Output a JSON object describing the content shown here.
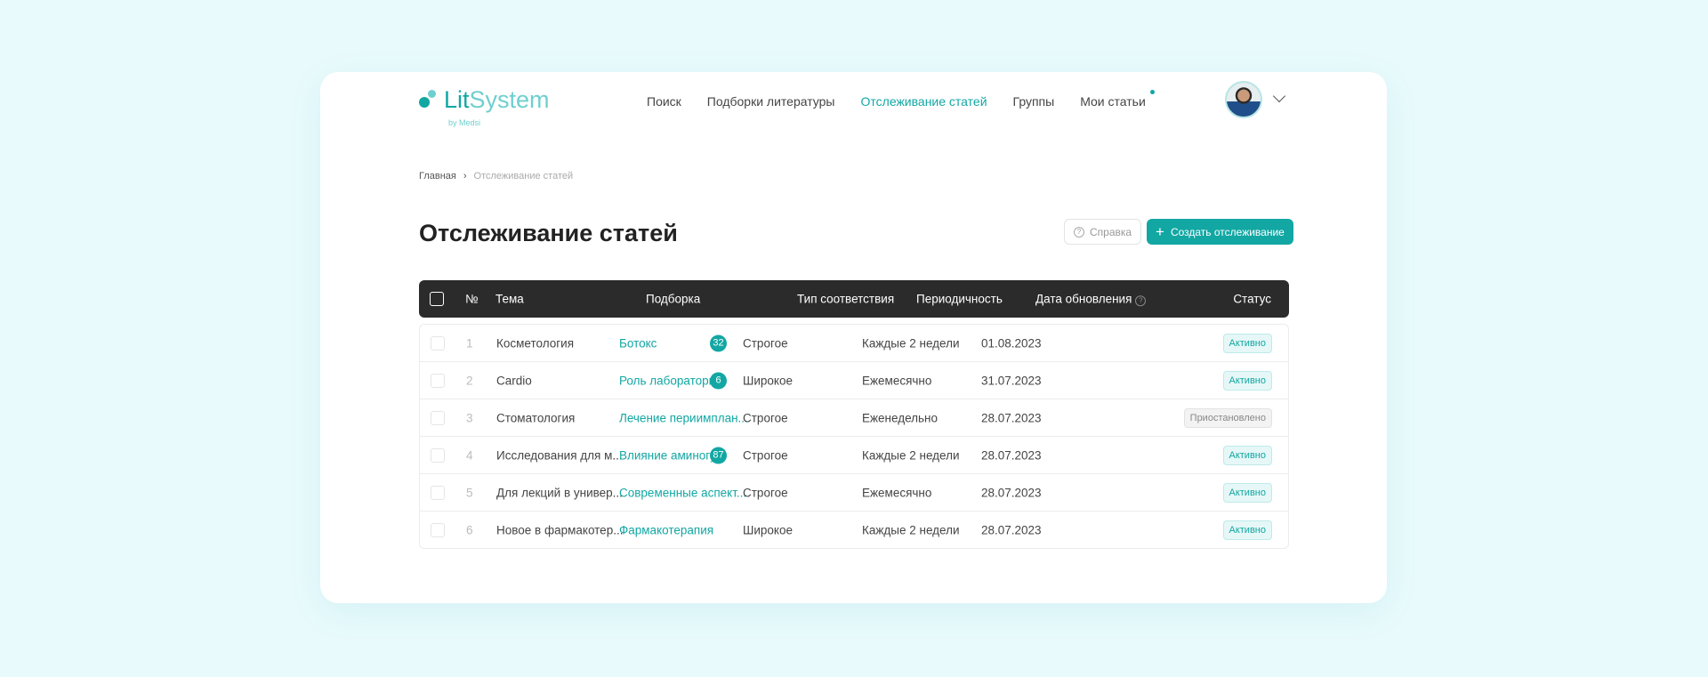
{
  "logo": {
    "name_a": "Lit",
    "name_b": "System",
    "sub": "by Medsi"
  },
  "nav": [
    {
      "label": "Поиск"
    },
    {
      "label": "Подборки литературы"
    },
    {
      "label": "Отслеживание статей",
      "active": true
    },
    {
      "label": "Группы"
    },
    {
      "label": "Мои статьи",
      "dot": true
    }
  ],
  "breadcrumb": {
    "home": "Главная",
    "sep": "›",
    "current": "Отслеживание статей"
  },
  "page_title": "Отслеживание статей",
  "buttons": {
    "help": "Справка",
    "create": "Создать отслеживание"
  },
  "table": {
    "headers": {
      "num": "№",
      "topic": "Тема",
      "collection": "Подборка",
      "match": "Тип соответствия",
      "period": "Периодичность",
      "date": "Дата обновления",
      "status": "Статус"
    },
    "rows": [
      {
        "num": "1",
        "topic": "Косметология",
        "collection": "Ботокс",
        "count": "32",
        "match": "Строгое",
        "period": "Каждые 2 недели",
        "date": "01.08.2023",
        "status": "Активно"
      },
      {
        "num": "2",
        "topic": "Cardio",
        "collection": "Роль лабораторн...",
        "count": "6",
        "match": "Широкое",
        "period": "Ежемесячно",
        "date": "31.07.2023",
        "status": "Активно"
      },
      {
        "num": "3",
        "topic": "Стоматология",
        "collection": "Лечение периимплан...",
        "count": null,
        "match": "Строгое",
        "period": "Еженедельно",
        "date": "28.07.2023",
        "status": "Приостановлено"
      },
      {
        "num": "4",
        "topic": "Исследования для м...",
        "collection": "Влияние аминогу...",
        "count": "87",
        "match": "Строгое",
        "period": "Каждые 2 недели",
        "date": "28.07.2023",
        "status": "Активно"
      },
      {
        "num": "5",
        "topic": "Для лекций в универ...",
        "collection": "Современные аспект...",
        "count": null,
        "match": "Строгое",
        "period": "Ежемесячно",
        "date": "28.07.2023",
        "status": "Активно"
      },
      {
        "num": "6",
        "topic": "Новое в фармакотер...",
        "collection": "Фармакотерапия",
        "count": null,
        "match": "Широкое",
        "period": "Каждые 2 недели",
        "date": "28.07.2023",
        "status": "Активно"
      }
    ]
  },
  "colors": {
    "accent": "#12a7a3",
    "header_bg": "#2b2b2b",
    "page_bg": "#e8fafc"
  }
}
